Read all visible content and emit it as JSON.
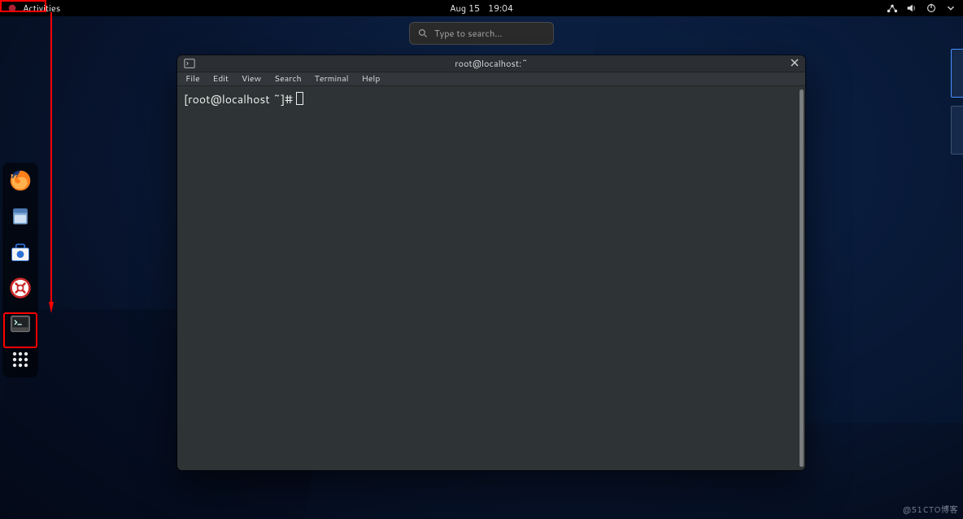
{
  "topbar": {
    "activities_label": "Activities",
    "date": "Aug 15",
    "time": "19:04",
    "icons": {
      "network": "network-icon",
      "volume": "volume-icon",
      "power": "power-icon",
      "arrow": "chevron-down-icon"
    }
  },
  "search": {
    "placeholder": "Type to search…"
  },
  "dock": {
    "items": [
      {
        "name": "firefox",
        "label": "Firefox"
      },
      {
        "name": "files",
        "label": "Files"
      },
      {
        "name": "software",
        "label": "Software"
      },
      {
        "name": "help",
        "label": "Help"
      },
      {
        "name": "terminal",
        "label": "Terminal"
      },
      {
        "name": "apps",
        "label": "Show Applications"
      }
    ]
  },
  "terminal": {
    "title": "root@localhost:~",
    "menus": {
      "file": "File",
      "edit": "Edit",
      "view": "View",
      "search": "Search",
      "terminal": "Terminal",
      "help": "Help"
    },
    "prompt": "[root@localhost ~]# "
  },
  "workspaces": {
    "count": 2,
    "active_index": 0
  },
  "watermark": "@51CTO博客"
}
